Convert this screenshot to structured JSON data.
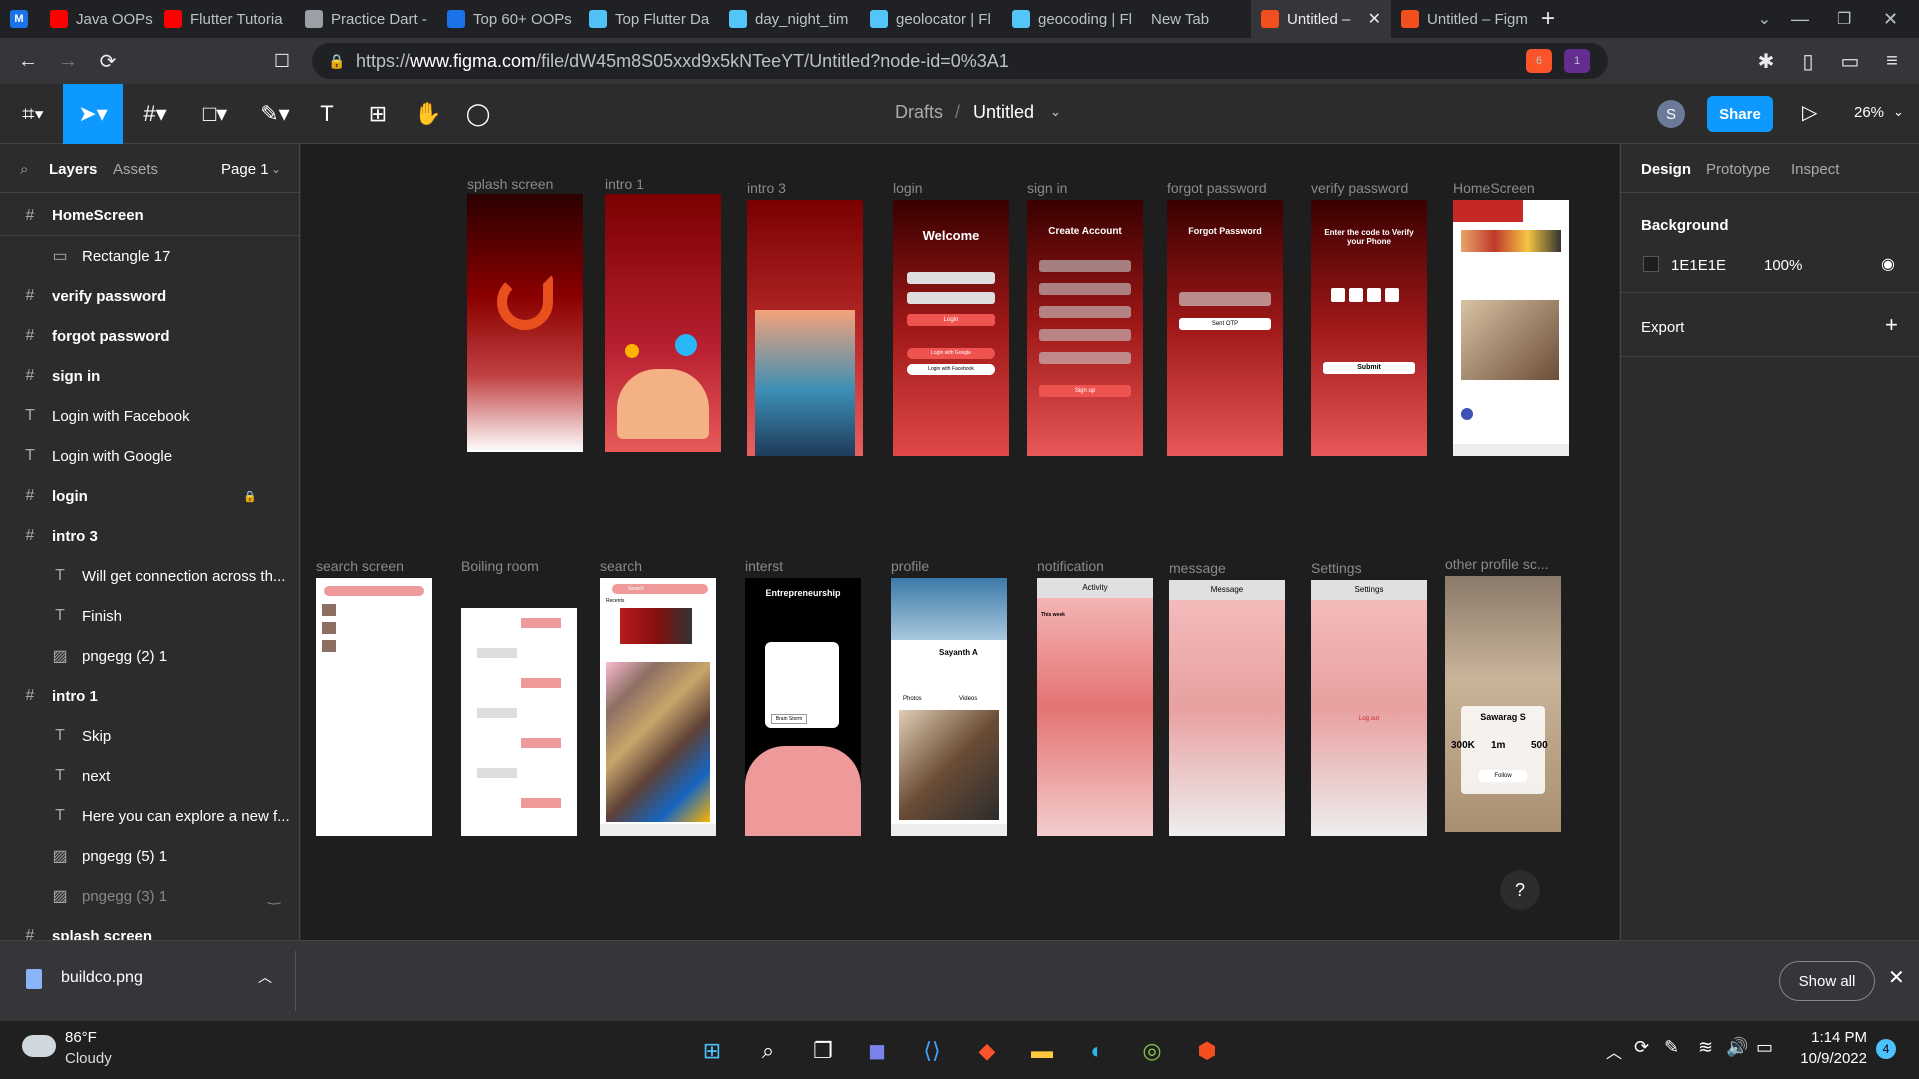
{
  "browser": {
    "tabs": [
      {
        "label": "Java OOPs Cor",
        "icon": "youtube-icon",
        "color": "#ff0000"
      },
      {
        "label": "Flutter Tutoria",
        "icon": "youtube-icon",
        "color": "#ff0000"
      },
      {
        "label": "Practice Dart -",
        "icon": "document-icon",
        "color": "#9aa0a6"
      },
      {
        "label": "Top 60+ OOPs",
        "icon": "site-icon",
        "color": "#1a73e8"
      },
      {
        "label": "Top Flutter Da",
        "icon": "shield-site-icon",
        "color": "#4fc3f7"
      },
      {
        "label": "day_night_tim",
        "icon": "flutter-icon",
        "color": "#54c5f8"
      },
      {
        "label": "geolocator | Fl",
        "icon": "flutter-icon",
        "color": "#54c5f8"
      },
      {
        "label": "geocoding | Fl",
        "icon": "flutter-icon",
        "color": "#54c5f8"
      },
      {
        "label": "New Tab",
        "icon": "",
        "color": "#9aa0a6"
      },
      {
        "label": "Untitled –",
        "icon": "figma-icon",
        "color": "#f24e1e"
      },
      {
        "label": "Untitled – Figm",
        "icon": "figma-icon",
        "color": "#f24e1e"
      }
    ],
    "url_prefix": "https://",
    "url_domain": "www.figma.com",
    "url_path": "/file/dW45m8S05xxd9x5kNTeeYT/Untitled?node-id=0%3A1",
    "brave_badge": "6",
    "alert_badge": "1"
  },
  "figma": {
    "breadcrumb_root": "Drafts",
    "breadcrumb_sep": "/",
    "file_name": "Untitled",
    "avatar_letter": "S",
    "share_label": "Share",
    "zoom": "26%",
    "left_tabs": {
      "layers": "Layers",
      "assets": "Assets",
      "page": "Page 1"
    },
    "layers": [
      {
        "label": "HomeScreen",
        "type": "frame",
        "bold": true,
        "indent": 0
      },
      {
        "label": "Rectangle 17",
        "type": "rect",
        "bold": false,
        "indent": 1
      },
      {
        "label": "verify password",
        "type": "frame",
        "bold": true,
        "indent": 0
      },
      {
        "label": "forgot password",
        "type": "frame",
        "bold": true,
        "indent": 0
      },
      {
        "label": "sign in",
        "type": "frame",
        "bold": true,
        "indent": 0
      },
      {
        "label": "Login with Facebook",
        "type": "text",
        "bold": false,
        "indent": 0
      },
      {
        "label": "Login with Google",
        "type": "text",
        "bold": false,
        "indent": 0
      },
      {
        "label": "login",
        "type": "frame",
        "bold": true,
        "indent": 0,
        "locked": true
      },
      {
        "label": "intro 3",
        "type": "frame",
        "bold": true,
        "indent": 0
      },
      {
        "label": "Will get connection across th...",
        "type": "text",
        "bold": false,
        "indent": 1
      },
      {
        "label": "Finish",
        "type": "text",
        "bold": false,
        "indent": 1
      },
      {
        "label": "pngegg (2) 1",
        "type": "image",
        "bold": false,
        "indent": 1
      },
      {
        "label": "intro 1",
        "type": "frame",
        "bold": true,
        "indent": 0
      },
      {
        "label": "Skip",
        "type": "text",
        "bold": false,
        "indent": 1
      },
      {
        "label": "next",
        "type": "text",
        "bold": false,
        "indent": 1
      },
      {
        "label": "Here you can explore a new f...",
        "type": "text",
        "bold": false,
        "indent": 1
      },
      {
        "label": "pngegg (5) 1",
        "type": "image",
        "bold": false,
        "indent": 1
      },
      {
        "label": "pngegg (3) 1",
        "type": "image",
        "bold": false,
        "indent": 1,
        "hidden": true
      },
      {
        "label": "splash screen",
        "type": "frame",
        "bold": true,
        "indent": 0
      }
    ],
    "right_tabs": {
      "design": "Design",
      "prototype": "Prototype",
      "inspect": "Inspect"
    },
    "background_title": "Background",
    "background_hex": "1E1E1E",
    "background_opacity": "100%",
    "export_label": "Export",
    "help_label": "?",
    "frames_row1": [
      "splash screen",
      "intro 1",
      "intro 3",
      "login",
      "sign in",
      "forgot password",
      "verify password",
      "HomeScreen"
    ],
    "frames_row2": [
      "search screen",
      "Boiling room",
      "search",
      "interst",
      "profile",
      "notification",
      "message",
      "Settings",
      "other profile sc..."
    ],
    "frame_text": {
      "welcome": "Welcome",
      "login_btn": "Login",
      "login_google": "Login with Google",
      "login_facebook": "Login with Facebook",
      "create_account": "Create Account",
      "sign_up": "Sign up",
      "forgot_password": "Forgot Password",
      "sent_otp": "Sent OTP",
      "enter_code": "Enter the code to Verify your Phone",
      "submit": "Submit",
      "entrepreneurship": "Entrepreneurship",
      "brain_storm": "Brain Storm",
      "sayanth": "Sayanth A",
      "photos": "Photos",
      "videos": "Videos",
      "activity": "Activity",
      "this_week": "This week",
      "message": "Message",
      "settings": "Settings",
      "log_out": "Log out",
      "sawarag": "Sawarag S",
      "stat1": "300K",
      "stat2": "1m",
      "stat3": "500",
      "follow": "Follow",
      "search": "Search",
      "recents": "Recents"
    }
  },
  "shelf": {
    "file": "buildco.png",
    "show_all": "Show all"
  },
  "taskbar": {
    "temp": "86°F",
    "weather": "Cloudy",
    "time": "1:14 PM",
    "date": "10/9/2022",
    "notif": "4"
  }
}
